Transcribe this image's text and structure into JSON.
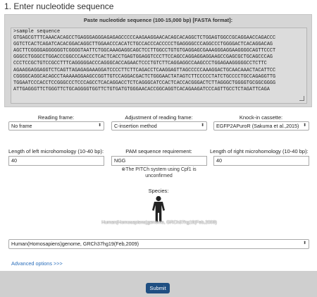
{
  "section_title": "1. Enter nucleotide sequence",
  "sequence_panel": {
    "title": "Paste nucleotide sequence (100-15,000 bp) [FASTA format]:",
    "value": ">sample sequence\nGTGAGCGTTTCAAACACAGCCTGAGGGAGGGAGAGAGCCCCCAAGAAGGAACACAGCACAGGCTCTGGAGTGGCCGCAGGAACCAGACCC\nGGTCTCACTCAGATCACACGGACAGGCTTGGAACCCACATCTGCCACCCACCCCCTGAGGGGCCCAGGCCCTGGGGACTCACAGGACAG\nAGCTTCGGGGAGGGGGGTCGGGGTAATTCTGGCAAAGAGGCAGCTCCTTGGCCTGTGTGAGGAGCGAAAGGGAGGAAGGGGCAGTTCCCT\nGGGCCTGGGCCTGGACCCGGCCCAACCCTCACTCACCTGAGTGGAGGTCCCTTCCAGCCAGGAGGAGGAAGCCGAGCGCTGCAGCCCAG\nCCCTCCGCTGTCCGCCTTTCAGGGGGACCCAGGGCACCAGAACTCCCTGTCTTCAGGAGGCCAAGCCCTGGAGAAGGGGGCCTCTTC\nAGAAGGAGGAGGTCTCAGTTAGAGAGAAAGGATCCCCTTCTTCAGACCTCAAGGAGTTAGCCCCCAAAGGACTGCAACAAACTACATTCC\nCGGGGCAGGCACAGCCTAAAAAGGAAGCCGGTTGTCCAGGACGACTCTGGGAACTATAGTCTTCCCCCTATCTGCCCCTGCCAGAGGTTG\nTGGAATCCCACCTCCGGGCCCTCCCAGCCTCACAGGACCTCTCAGGGCATCCACTCACCACGGGACTCTTAGGGCTGGGGTGCGGCGGGG\nATTGAGGGTTCTGGGTTCTGCAGGGGTGGTTCTGTGATGTGGGAACACCGGCAGGTCACAGAAGATCCCAGTTGCCTCTAGATTCAGA"
  },
  "reading_frame": {
    "label": "Reading frame:",
    "value": "No frame"
  },
  "adjustment": {
    "label": "Adjustment of reading frame:",
    "value": "C-insertion method"
  },
  "knockin": {
    "label": "Knock-in cassette:",
    "value": "EGFP2APuroR (Sakuma et al.,2015)"
  },
  "left_microhomology": {
    "label": "Length of left microhomology (10-40 bp):",
    "value": "40"
  },
  "pam": {
    "label": "PAM sequence requirement:",
    "value": "NGG",
    "note_line1": "⊗The PITCh system using Cpf1 is",
    "note_line2": "unconfirmed"
  },
  "right_microhomology": {
    "label": "Length of right microhomology (10-40 bp):",
    "value": "40"
  },
  "species": {
    "label": "Species:",
    "caption": "Human(Homosapiens)genome, GRCh37hg19(Feb,2009)",
    "value": "Human(Homosapiens)genome, GRCh37hg19(Feb,2009)"
  },
  "advanced_options": "Advanced options >>>",
  "submit_label": "Submit",
  "icons": {
    "select_arrow": "⬍"
  },
  "colors": {
    "accent": "#1f4f82",
    "link": "#2a6ebb"
  }
}
